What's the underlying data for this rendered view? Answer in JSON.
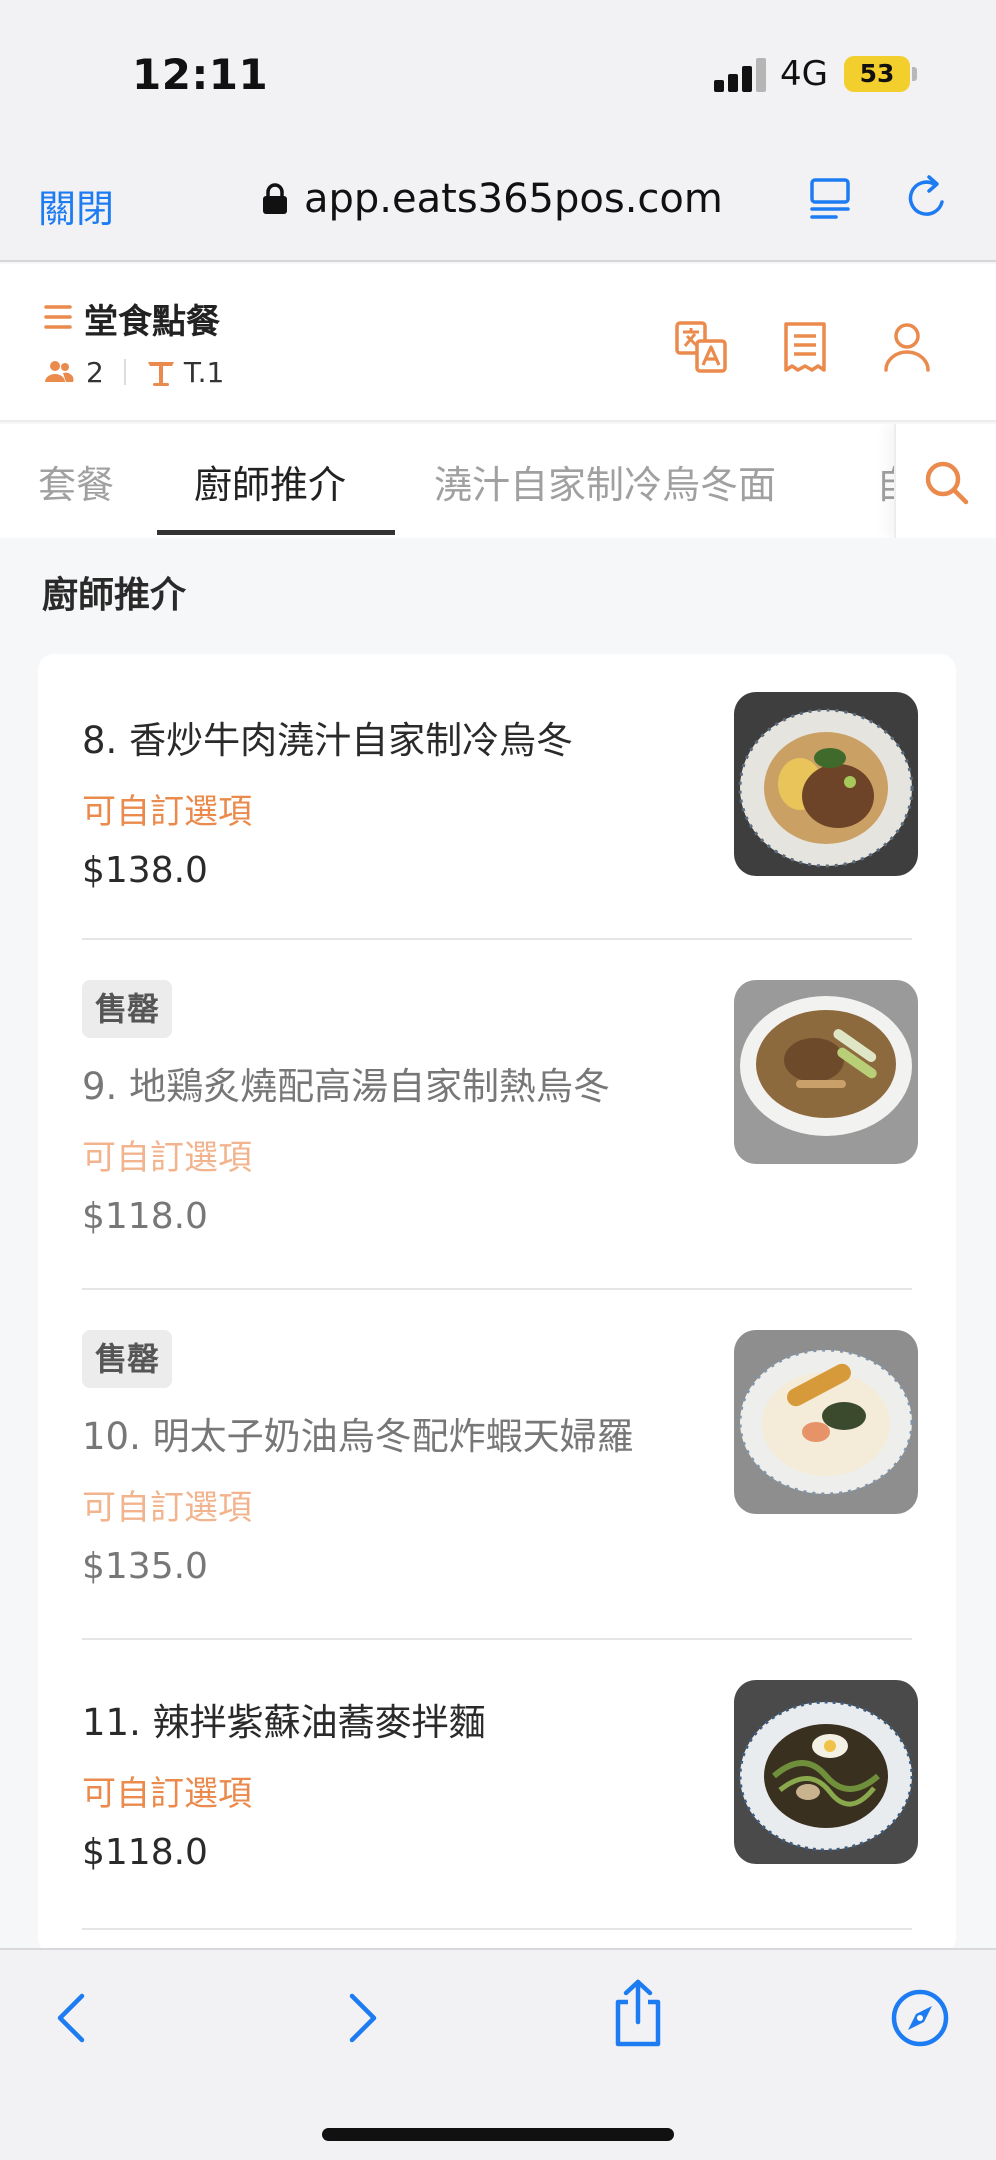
{
  "status_bar": {
    "time": "12:11",
    "network": "4G",
    "battery": "53"
  },
  "browser": {
    "close_label": "關閉",
    "url": "app.eats365pos.com"
  },
  "header": {
    "title": "堂食點餐",
    "guests": "2",
    "table": "T.1"
  },
  "tabs": [
    {
      "label": "套餐"
    },
    {
      "label": "廚師推介"
    },
    {
      "label": "澆汁自家制冷烏冬面"
    },
    {
      "label": "自"
    }
  ],
  "section": {
    "title": "廚師推介"
  },
  "menu_items": [
    {
      "name": "8. 香炒牛肉澆汁自家制冷烏冬",
      "option": "可自訂選項",
      "price": "$138.0",
      "badge": ""
    },
    {
      "name": "9. 地鶏炙燒配高湯自家制熱烏冬",
      "option": "可自訂選項",
      "price": "$118.0",
      "badge": "售罄"
    },
    {
      "name": "10. 明太子奶油烏冬配炸蝦天婦羅",
      "option": "可自訂選項",
      "price": "$135.0",
      "badge": "售罄"
    },
    {
      "name": "11. 辣拌紫蘇油蕎麥拌麵",
      "option": "可自訂選項",
      "price": "$118.0",
      "badge": ""
    }
  ],
  "colors": {
    "accent": "#ea8a4c",
    "ios_blue": "#1e7cf2",
    "battery": "#f3cf2e"
  },
  "icons": {
    "browser": [
      "lock-icon",
      "reader-icon",
      "reload-icon"
    ],
    "header": [
      "menu-icon",
      "people-icon",
      "table-icon",
      "translate-icon",
      "receipt-icon",
      "user-icon"
    ],
    "toolbar": [
      "back-icon",
      "forward-icon",
      "share-icon",
      "compass-icon"
    ]
  }
}
